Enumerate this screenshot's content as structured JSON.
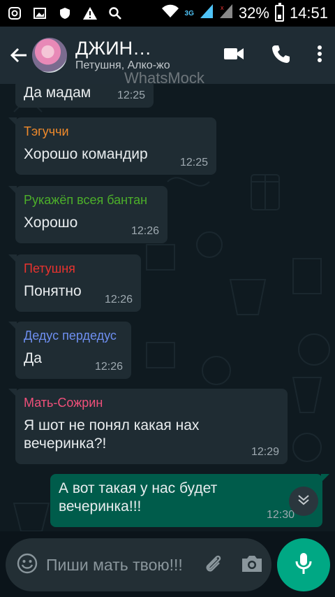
{
  "status_bar": {
    "network_label": "3G",
    "battery_percent": "32%",
    "time": "14:51",
    "icons": [
      "instagram-icon",
      "gallery-icon",
      "shield-icon",
      "warning-icon",
      "search-icon",
      "wifi-icon",
      "signal-icon",
      "signal-off-icon",
      "battery-icon"
    ]
  },
  "header": {
    "title": "ДЖИН…",
    "subtitle": "Петушня, Алко-жо",
    "watermark": "WhatsMock",
    "icons": [
      "back-arrow-icon",
      "video-call-icon",
      "phone-icon",
      "more-vert-icon"
    ]
  },
  "messages": [
    {
      "sender": "",
      "sender_color": "",
      "text": "Да мадам",
      "time": "12:25",
      "direction": "in"
    },
    {
      "sender": "Тэгуччи",
      "sender_color": "#f08a2b",
      "text": "Хорошо командир",
      "time": "12:25",
      "direction": "in"
    },
    {
      "sender": "Рукажёп всея бантан",
      "sender_color": "#4caf2a",
      "text": "Хорошо",
      "time": "12:26",
      "direction": "in"
    },
    {
      "sender": "Петушня",
      "sender_color": "#e8332f",
      "text": "Понятно",
      "time": "12:26",
      "direction": "in"
    },
    {
      "sender": "Дедус пердедус",
      "sender_color": "#6e8ff0",
      "text": "Да",
      "time": "12:26",
      "direction": "in"
    },
    {
      "sender": "Мать-Сожрин",
      "sender_color": "#f0507a",
      "text": "Я шот не понял какая нах вечеринка?!",
      "time": "12:29",
      "direction": "in"
    },
    {
      "sender": "",
      "sender_color": "",
      "text": "А вот такая у нас будет вечеринка!!!",
      "time": "12:30",
      "direction": "out"
    }
  ],
  "input": {
    "placeholder": "Пиши мать твою!!!",
    "icons": [
      "emoji-icon",
      "attach-icon",
      "camera-icon",
      "mic-icon",
      "scroll-down-icon"
    ]
  },
  "colors": {
    "header_bg": "#1f2c34",
    "incoming_bubble": "#1f2c33",
    "outgoing_bubble": "#005c4b",
    "accent": "#00a884"
  }
}
